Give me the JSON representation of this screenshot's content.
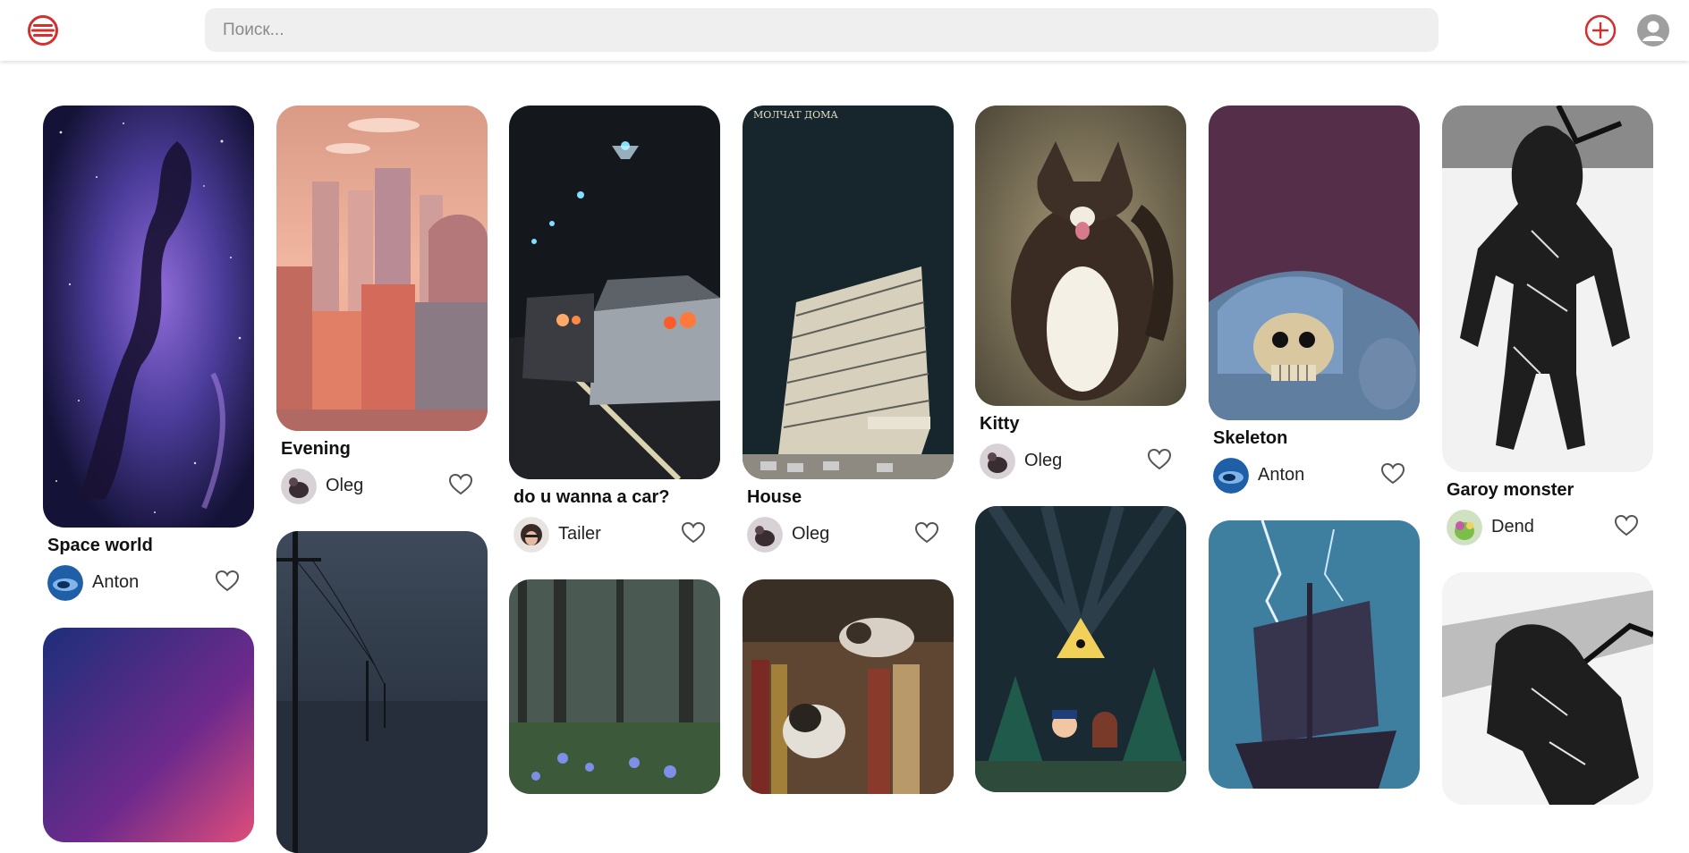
{
  "header": {
    "logo_icon": "pinterest-style-logo-icon",
    "search_placeholder": "Поиск...",
    "add_icon": "plus-circle-icon",
    "profile_icon": "user-avatar-icon",
    "accent_color": "#d32f2f"
  },
  "pins": [
    {
      "title": "Space world",
      "author": "Anton"
    },
    {
      "title": "Evening",
      "author": "Oleg"
    },
    {
      "title": "do u wanna a car?",
      "author": "Tailer"
    },
    {
      "title": "House",
      "author": "Oleg",
      "image_text": "МОЛЧАТ ДОМА"
    },
    {
      "title": "Kitty",
      "author": "Oleg"
    },
    {
      "title": "Skeleton",
      "author": "Anton"
    },
    {
      "title": "Garoy monster",
      "author": "Dend"
    }
  ],
  "icons": {
    "like": "heart-outline-icon"
  }
}
